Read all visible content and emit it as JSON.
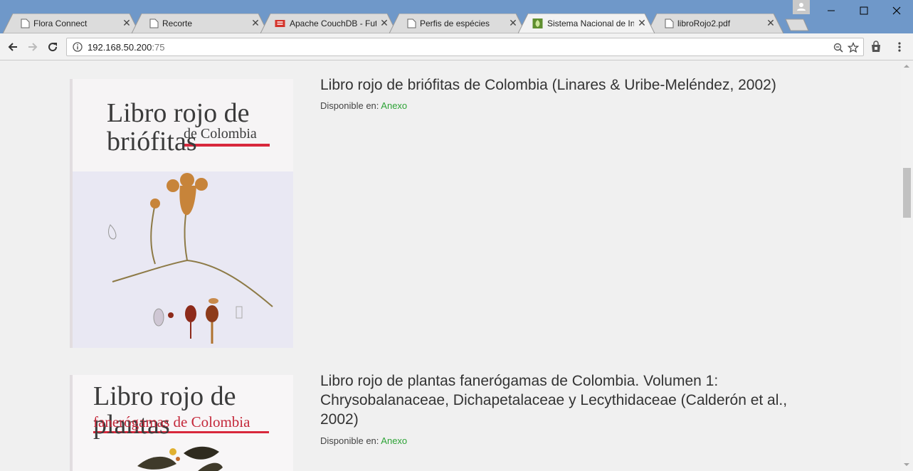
{
  "browser": {
    "tabs": [
      {
        "title": "Flora Connect",
        "icon": "page-icon",
        "active": false
      },
      {
        "title": "Recorte",
        "icon": "page-icon",
        "active": false
      },
      {
        "title": "Apache CouchDB - Fut",
        "icon": "couchdb-icon",
        "active": false
      },
      {
        "title": "Perfis de espécies",
        "icon": "page-icon",
        "active": false
      },
      {
        "title": "Sistema Nacional de In",
        "icon": "site-leaf-icon",
        "active": true
      },
      {
        "title": "libroRojo2.pdf",
        "icon": "page-icon",
        "active": false
      }
    ],
    "address": {
      "host": "192.168.50.200",
      "port": ":75"
    },
    "colors": {
      "titlebar": "#6f98c9",
      "link": "#2da336"
    }
  },
  "entries": [
    {
      "title": "Libro rojo de briófitas de Colombia (Linares & Uribe-Meléndez, 2002)",
      "available_label": "Disponible en:",
      "link_label": "Anexo",
      "cover": {
        "line1": "Libro rojo de briófitas",
        "line2": "de Colombia"
      }
    },
    {
      "title": "Libro rojo de plantas fanerógamas de Colombia. Volumen 1: Chrysobalanaceae, Dichapetalaceae y Lecythidaceae (Calderón et al., 2002)",
      "available_label": "Disponible en:",
      "link_label": "Anexo",
      "cover": {
        "line1": "Libro rojo de plantas",
        "line2": "fanerógamas de Colombia"
      }
    }
  ]
}
